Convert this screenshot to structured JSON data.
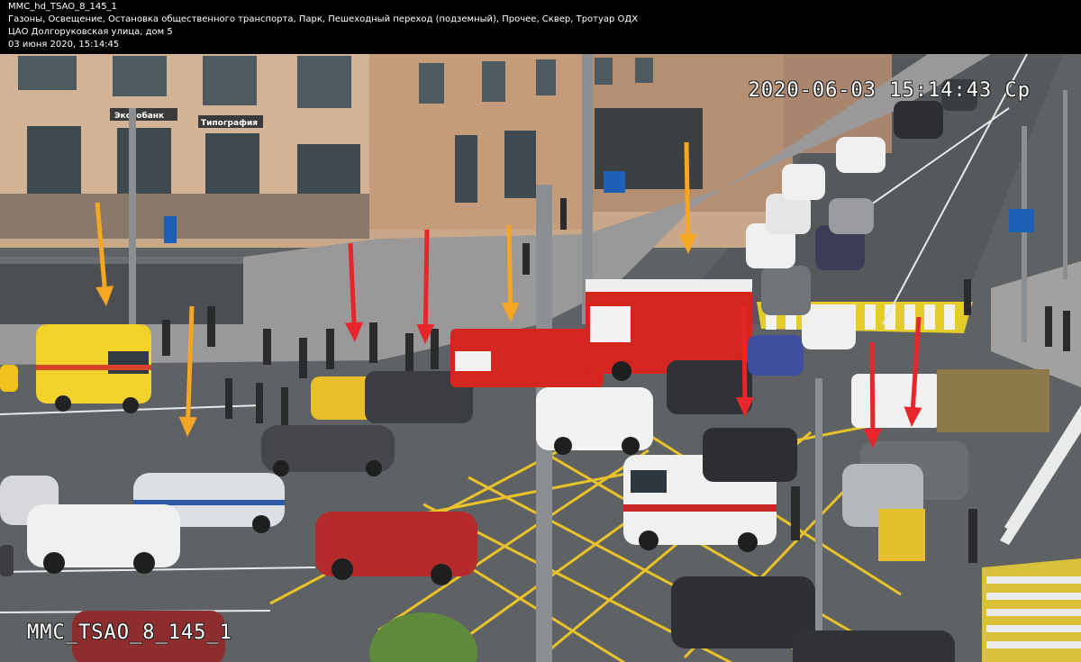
{
  "header": {
    "camera_id": "MMC_hd_TSAO_8_145_1",
    "categories": "Газоны, Освещение, Остановка общественного транспорта, Парк, Пешеходный переход (подземный), Прочее, Сквер, Тротуар ОДХ",
    "address": "ЦАО Долгоруковская улица, дом 5",
    "datetime": "03 июня 2020, 15:14:45"
  },
  "overlay": {
    "timestamp": "2020-06-03 15:14:43 Ср",
    "camera_label": "MMC_TSAO_8_145_1"
  },
  "signage": {
    "bank_sign": "Экспобанк",
    "shop_sign": "Типография"
  },
  "colors": {
    "arrow_orange": "#f5a623",
    "arrow_red": "#e8252b",
    "road_marking_yellow": "#e8c228",
    "ambulance_yellow": "#f3d22a",
    "fire_truck_red": "#d4251f"
  }
}
